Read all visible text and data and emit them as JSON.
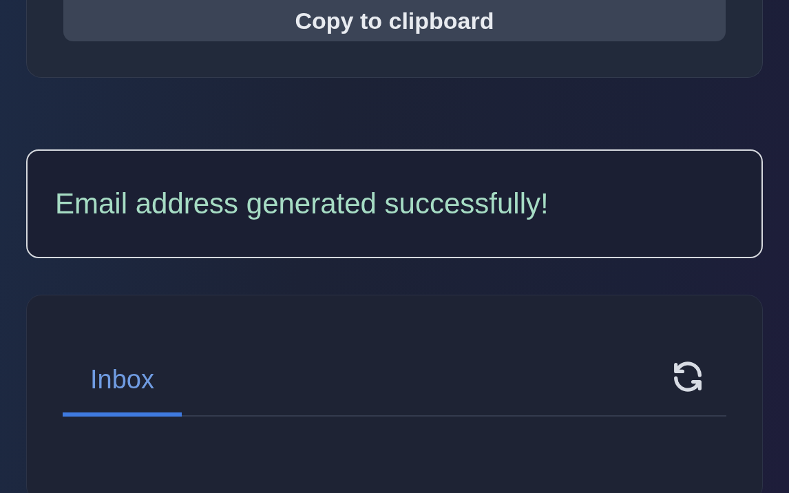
{
  "copy_button": {
    "label": "Copy to clipboard"
  },
  "alert": {
    "message": "Email address generated successfully!"
  },
  "mailbox": {
    "tabs": [
      {
        "label": "Inbox",
        "selected": true
      }
    ]
  }
}
